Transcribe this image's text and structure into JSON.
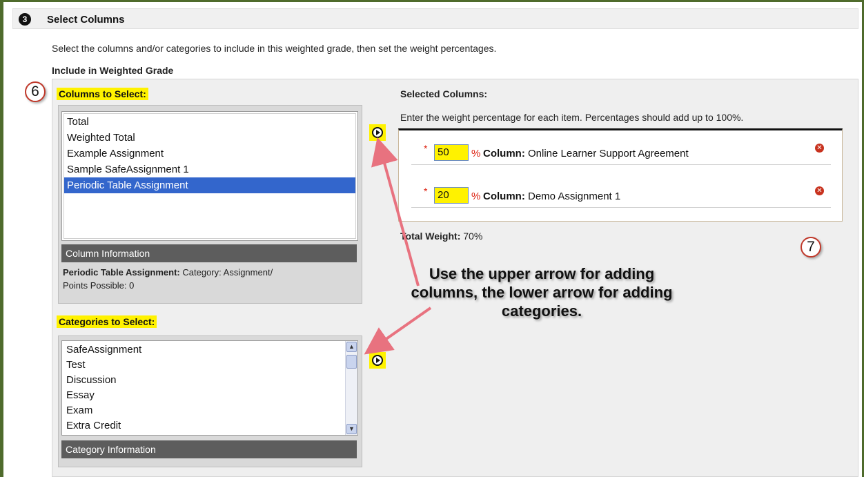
{
  "step": {
    "number": "3",
    "title": "Select Columns"
  },
  "instructions": "Select the columns and/or categories to include in this weighted grade, then set the weight percentages.",
  "include_label": "Include in Weighted Grade",
  "callouts": {
    "left": "6",
    "right": "7"
  },
  "columns_panel": {
    "title": "Columns to Select:",
    "items": [
      {
        "label": "Total",
        "selected": false
      },
      {
        "label": "Weighted Total",
        "selected": false
      },
      {
        "label": "Example Assignment",
        "selected": false
      },
      {
        "label": "Sample SafeAssignment 1",
        "selected": false
      },
      {
        "label": "Periodic Table Assignment",
        "selected": true
      }
    ],
    "info_header": "Column Information",
    "info_name": "Periodic Table Assignment:",
    "info_detail": "Category: Assignment/",
    "info_points": "Points Possible: 0"
  },
  "categories_panel": {
    "title": "Categories to Select:",
    "items": [
      {
        "label": "SafeAssignment"
      },
      {
        "label": "Test"
      },
      {
        "label": "Discussion"
      },
      {
        "label": "Essay"
      },
      {
        "label": "Exam"
      },
      {
        "label": "Extra Credit"
      }
    ],
    "info_header": "Category Information"
  },
  "selected": {
    "title": "Selected Columns:",
    "instruction": "Enter the weight percentage for each item. Percentages should add up to 100%.",
    "rows": [
      {
        "weight": "50",
        "prefix": "Column:",
        "name": "Online Learner Support Agreement"
      },
      {
        "weight": "20",
        "prefix": "Column:",
        "name": "Demo Assignment 1"
      }
    ],
    "required_mark": "*",
    "percent_sign": "%",
    "total_label": "Total Weight:",
    "total_value": "70%"
  },
  "annotation": "Use the upper arrow for adding columns, the lower arrow for adding categories.",
  "icons": {
    "add_column": "play-circle-icon",
    "add_category": "play-circle-icon",
    "remove": "remove-circle-icon",
    "scroll_up": "chevron-up-icon",
    "scroll_down": "chevron-down-icon"
  },
  "colors": {
    "highlight": "#fff200",
    "frame": "#4f6b2c",
    "selection": "#3366cc",
    "remove": "#c8321e",
    "annotation_arrow": "#e8727f"
  }
}
